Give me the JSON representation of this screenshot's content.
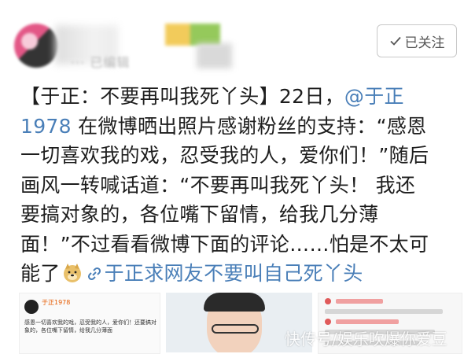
{
  "header": {
    "meta_text": "··· 已编辑",
    "follow_label": "已关注"
  },
  "post": {
    "lines": [
      {
        "pre": "【于正：不要再叫我死丫头】22日，",
        "mention": "@于正"
      },
      {
        "mention": "1978",
        "post": " 在微博晒出照片感谢粉丝的支持：“感恩"
      },
      {
        "text": "一切喜欢我的戏，忍受我的人，爱你们！”随后"
      },
      {
        "text": "画风一转喊话道：“不要再叫我死丫头！ 我还"
      },
      {
        "text": "要搞对象的，各位嘴下留情，给我几分薄"
      },
      {
        "text": "面！”不过看看微博下面的评论……怕是不太可"
      },
      {
        "pre": "能了",
        "topic": "于正求网友不要叫自己死丫头"
      }
    ],
    "emoji": "doge-emoji",
    "link_icon": "link-icon"
  },
  "images": {
    "pic1_name": "于正1978",
    "pic1_text": "感恩一切喜欢我的戏，忍受我的人，爱你们！还要搞对象的，各位嘴下留情，给我几分薄面"
  },
  "watermark": "快传号/娱乐吹爆你爱豆",
  "colors": {
    "link": "#4a7fb8",
    "text": "#1e1e1e",
    "button_border": "#c8c8c8"
  }
}
